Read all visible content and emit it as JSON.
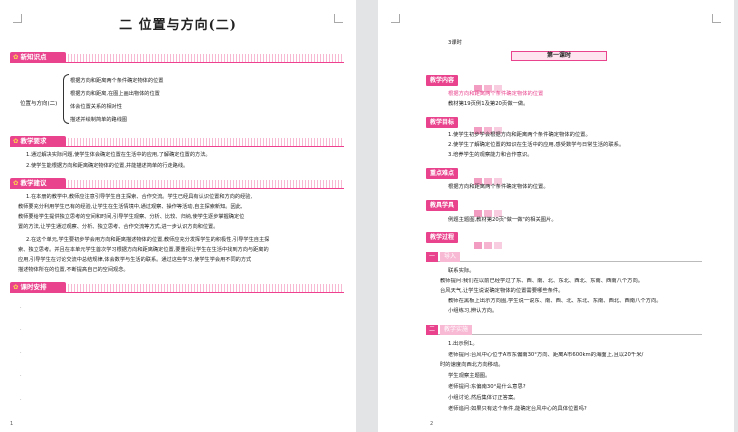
{
  "page1": {
    "title": "二 位置与方向(二)",
    "page_number": "1",
    "sections": {
      "knowledge": "新知识点",
      "requirements": "教学要求",
      "suggestions": "教学建议",
      "schedule": "课时安排"
    },
    "mindmap": {
      "root": "位置与方向(二)",
      "branches": [
        "根据方向和距离两个条件确定物体的位置",
        "根据方向和距离,在图上画出物体的位置",
        "体会位置关系的相对性",
        "描述并绘制简单的路线图"
      ]
    },
    "requirements": [
      "1.通过解决实际问题,使学生体会确定位置在生活中的应用,了解确定位置的方法。",
      "2.使学生能根据方向和距离确定物体的位置,并能描述简单的行走路线。"
    ],
    "suggestion_paragraphs": [
      [
        "1.在本册的教学中,教师应注意引导学生自主探索、合作交流。学生已经具有认识位置和方向的经验,",
        "教师要充分利用学生已有的经验,让学生在生活情境中,通过观察、操作等活动,自主探索新知。因此,",
        "教师要给学生提供独立思考的空间和时间,引导学生观察、分析、比较、归纳,使学生逐步掌握确定位",
        "置的方法,让学生通过观察、分析、独立思考、合作交流等方式,进一步认识方向和位置。"
      ],
      [
        "2.在这个单元,学生要初步学会用方向和距离描述物体的位置,教师应充分发挥学生的积极性,引导学生自主探",
        "索、独立思考。并且在本单元学生首次学习根据方向和距离确定位置,要重视让学生在生活中找到方向与距离的",
        "应用,引导学生在讨论交流中总结规律,体会数学与生活的联系。通过这些学习,使学生学会用不同的方式",
        "描述物体所在的位置,不断提高自己的空间观念。"
      ]
    ],
    "dots": [
      ".",
      ".",
      ".",
      ".",
      "."
    ]
  },
  "page2": {
    "page_number": "2",
    "hours": "3课时",
    "lesson_title": "第一课时",
    "tags": {
      "content": "教学内容",
      "goals": "教学目标",
      "keypoints": "重点难点",
      "tools": "教具学具",
      "process": "教学过程"
    },
    "content_lines": [
      "根据方向和距离两个条件确定物体的位置",
      "教材第19页例1及第20页做一做。"
    ],
    "goal_lines": [
      "1.使学生初步学会根据方向和距离两个条件确定物体的位置。",
      "2.使学生了解确定位置的知识在生活中的应用,感受数学与日常生活的联系。",
      "3.培养学生的观察能力和合作意识。"
    ],
    "keypoint_line": "根据方向和距离两个条件确定物体的位置。",
    "tool_line": "例题主题图,教材第20页\"做一做\"的相关图片。",
    "steps": [
      {
        "num": "一",
        "label": "导入"
      },
      {
        "num": "二",
        "label": "教学实施"
      }
    ],
    "intro_lines": [
      "联系实际。",
      "教师提问:我们在以前已经学过了东、西、南、北、东北、西北、东南、西南八个方向。",
      "台风天气,让学生说说确定物体的位置需要哪些条件。",
      "教师在黑板上出示方向图,学生说一说东、南、西、北、东北、东南、西北、西南八个方向。",
      "小组练习,辨认方向。"
    ],
    "practice_lines": [
      "1.出示例1。",
      "老师提问:台风中心位于A市东偏南30°方向、距离A市600km的海面上,且以20千米/",
      "时的速度向西北方向移动。",
      "学生观察主题图。",
      "老师提问:东偏南30°是什么意思?",
      "小组讨论,然后集体订正答案。",
      "老师追问:如果只有这个条件,能确定台风中心的具体位置吗?"
    ]
  }
}
